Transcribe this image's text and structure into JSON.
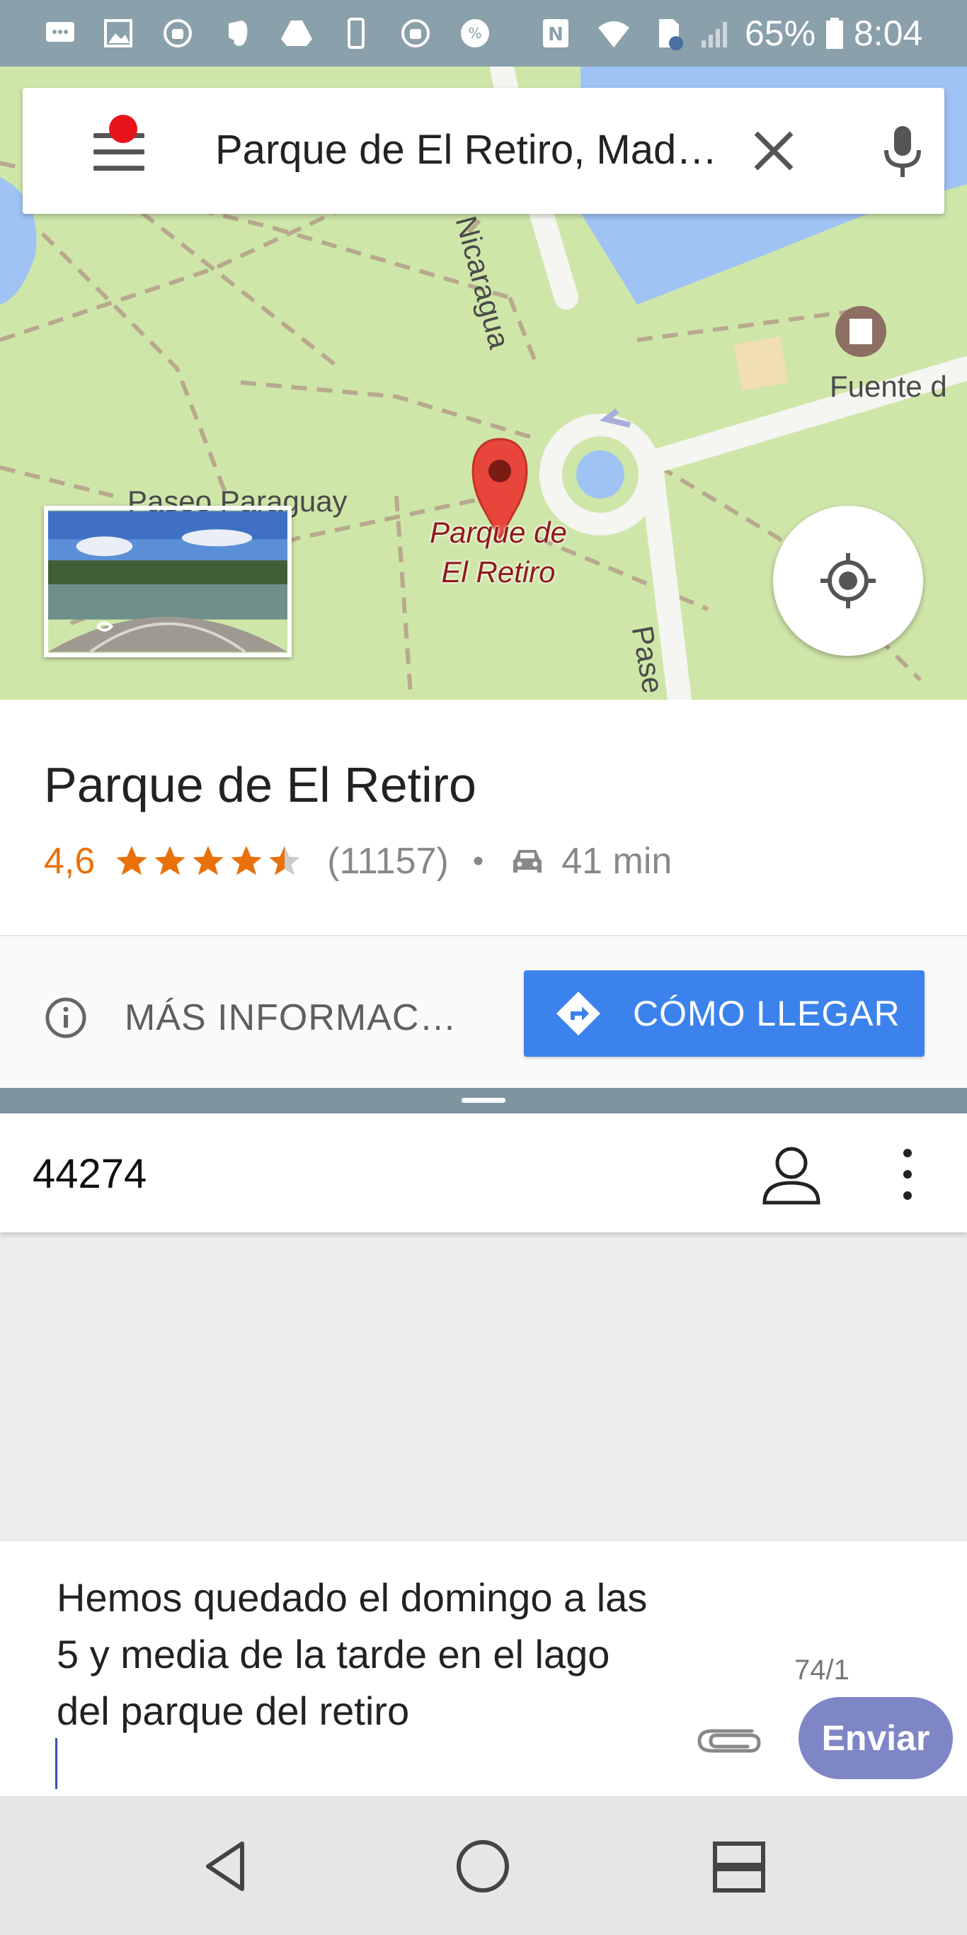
{
  "status_bar": {
    "battery_percent": "65%",
    "time": "8:04",
    "icons": [
      "message-icon",
      "gallery-icon",
      "android-sync-icon",
      "evernote-icon",
      "drive-icon",
      "phone-icon",
      "android-sync-icon",
      "percent-icon",
      "nfc-icon",
      "wifi-icon",
      "sim-icon",
      "signal-icon",
      "battery-icon"
    ]
  },
  "map": {
    "search": {
      "query": "Parque de El Retiro, Mad…"
    },
    "street_labels": {
      "nicaragua": "Nicaragua",
      "paraguay": "Paseo Paraguay",
      "fuente": "Fuente d",
      "paseo": "Pase"
    },
    "place_marker_label_line1": "Parque de",
    "place_marker_label_line2": "El Retiro",
    "marker_color": "#e8463a",
    "water_color": "#9fc3f5",
    "park_color": "#cfe6a9"
  },
  "place_card": {
    "title": "Parque de El Retiro",
    "rating": "4,6",
    "stars_value": 4.6,
    "review_count": "(11157)",
    "separator": "•",
    "drive_time": "41 min",
    "more_info_label": "MÁS INFORMAC…",
    "directions_label": "CÓMO LLEGAR",
    "accent_color": "#3b82ec",
    "rating_color": "#e8710a"
  },
  "sms": {
    "recipient": "44274",
    "message": "Hemos quedado el domingo a las 5 y media de la tarde en el lago del parque del retiro",
    "char_count": "74/1",
    "send_label": "Enviar",
    "send_color": "#7e86c6"
  },
  "nav": {
    "buttons": [
      "back-icon",
      "home-icon",
      "recents-icon"
    ]
  }
}
